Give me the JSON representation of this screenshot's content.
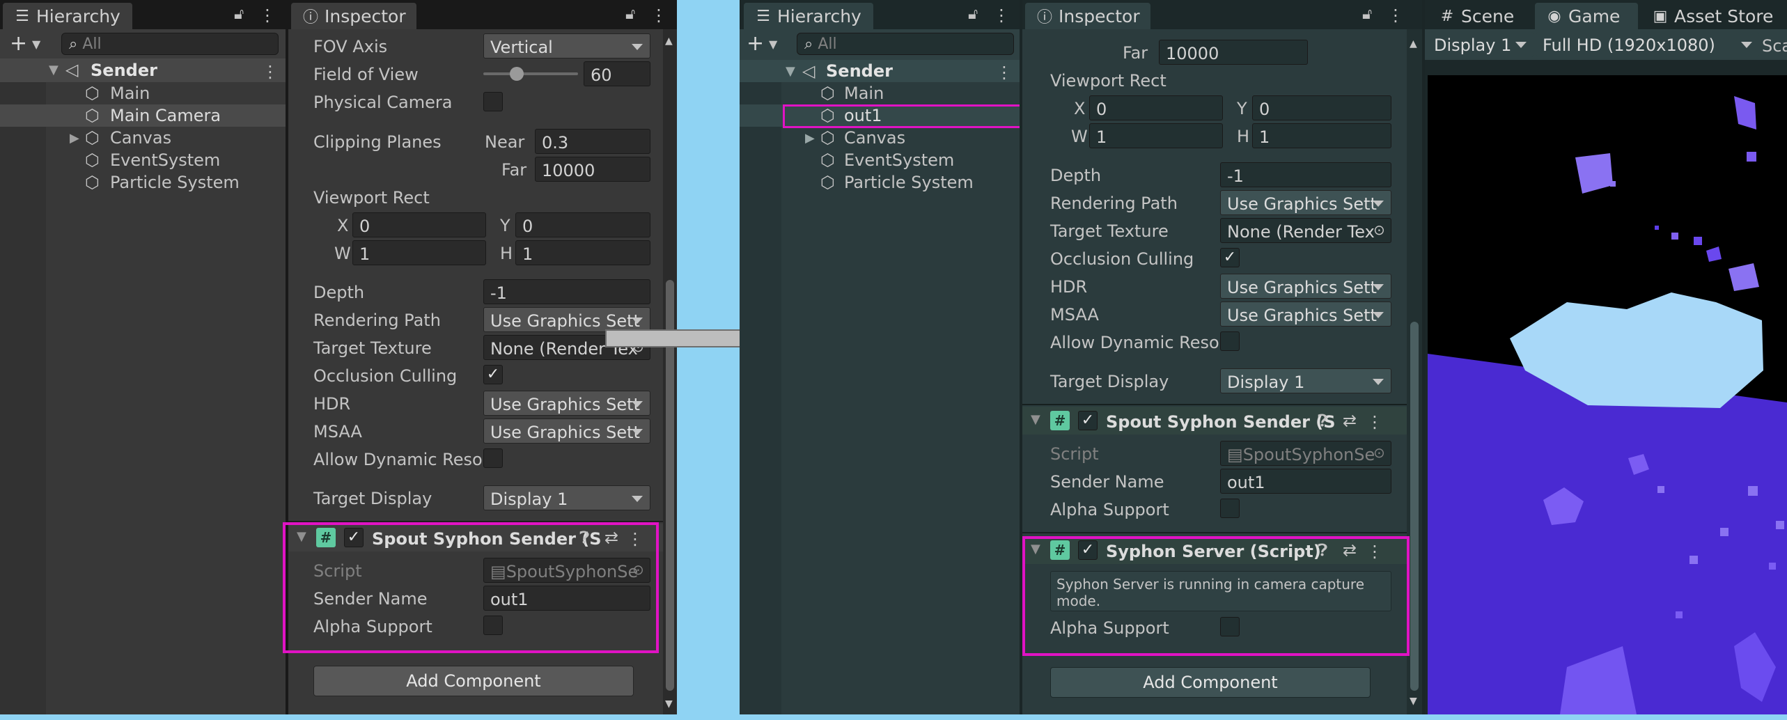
{
  "left": {
    "hierarchy": {
      "tab_label": "Hierarchy",
      "search_placeholder": "All",
      "root": "Sender",
      "items": [
        "Main",
        "Main Camera",
        "Canvas",
        "EventSystem",
        "Particle System"
      ]
    },
    "inspector": {
      "tab_label": "Inspector",
      "fov_axis": {
        "label": "FOV Axis",
        "value": "Vertical"
      },
      "field_of_view": {
        "label": "Field of View",
        "value": "60"
      },
      "physical_camera": "Physical Camera",
      "clipping": {
        "label": "Clipping Planes",
        "near_label": "Near",
        "near": "0.3",
        "far_label": "Far",
        "far": "10000"
      },
      "viewport": {
        "label": "Viewport Rect",
        "x_label": "X",
        "x": "0",
        "y_label": "Y",
        "y": "0",
        "w_label": "W",
        "w": "1",
        "h_label": "H",
        "h": "1"
      },
      "depth": {
        "label": "Depth",
        "value": "-1"
      },
      "rendering_path": {
        "label": "Rendering Path",
        "value": "Use Graphics Sett"
      },
      "target_texture": {
        "label": "Target Texture",
        "value": "None (Render Tex"
      },
      "occlusion": {
        "label": "Occlusion Culling",
        "value": "✓"
      },
      "hdr": {
        "label": "HDR",
        "value": "Use Graphics Sett"
      },
      "msaa": {
        "label": "MSAA",
        "value": "Use Graphics Sett"
      },
      "dynamic_res": "Allow Dynamic Resol",
      "target_display": {
        "label": "Target Display",
        "value": "Display 1"
      },
      "component": {
        "title": "Spout Syphon Sender (S",
        "check": "✓",
        "script_label": "Script",
        "script_value": "SpoutSyphonSe",
        "sender_name_label": "Sender Name",
        "sender_name_value": "out1",
        "alpha_label": "Alpha Support"
      },
      "add_component": "Add Component"
    }
  },
  "right": {
    "hierarchy": {
      "tab_label": "Hierarchy",
      "search_placeholder": "All",
      "root": "Sender",
      "items": [
        "Main",
        "out1",
        "Canvas",
        "EventSystem",
        "Particle System"
      ]
    },
    "inspector": {
      "tab_label": "Inspector",
      "clipping_far_label": "Far",
      "clipping_far_value": "10000",
      "viewport": {
        "label": "Viewport Rect",
        "x_label": "X",
        "x": "0",
        "y_label": "Y",
        "y": "0",
        "w_label": "W",
        "w": "1",
        "h_label": "H",
        "h": "1"
      },
      "depth": {
        "label": "Depth",
        "value": "-1"
      },
      "rendering_path": {
        "label": "Rendering Path",
        "value": "Use Graphics Sett"
      },
      "target_texture": {
        "label": "Target Texture",
        "value": "None (Render Tex"
      },
      "occlusion": {
        "label": "Occlusion Culling",
        "value": "✓"
      },
      "hdr": {
        "label": "HDR",
        "value": "Use Graphics Sett"
      },
      "msaa": {
        "label": "MSAA",
        "value": "Use Graphics Sett"
      },
      "dynamic_res": "Allow Dynamic Resol",
      "target_display": {
        "label": "Target Display",
        "value": "Display 1"
      },
      "spout_component": {
        "title": "Spout Syphon Sender (S",
        "check": "✓",
        "script_label": "Script",
        "script_value": "SpoutSyphonSe",
        "sender_name_label": "Sender Name",
        "sender_name_value": "out1",
        "alpha_label": "Alpha Support"
      },
      "syphon_component": {
        "title": "Syphon Server (Script)",
        "check": "✓",
        "info_line1": "Syphon Server is running in camera capture",
        "info_line2": "mode.",
        "alpha_label": "Alpha Support"
      },
      "add_component": "Add Component"
    },
    "game": {
      "tabs": [
        {
          "label": "Scene",
          "icon": "#"
        },
        {
          "label": "Game",
          "icon": "◉"
        },
        {
          "label": "Asset Store",
          "icon": "▣"
        }
      ],
      "display": "Display 1",
      "resolution": "Full HD (1920x1080)",
      "scale_label": "Sca"
    }
  },
  "colors": {
    "background": "#8fd3f3",
    "highlight": "#e013c4",
    "panel": "#383838",
    "panel_right": "#2b3b3d"
  }
}
